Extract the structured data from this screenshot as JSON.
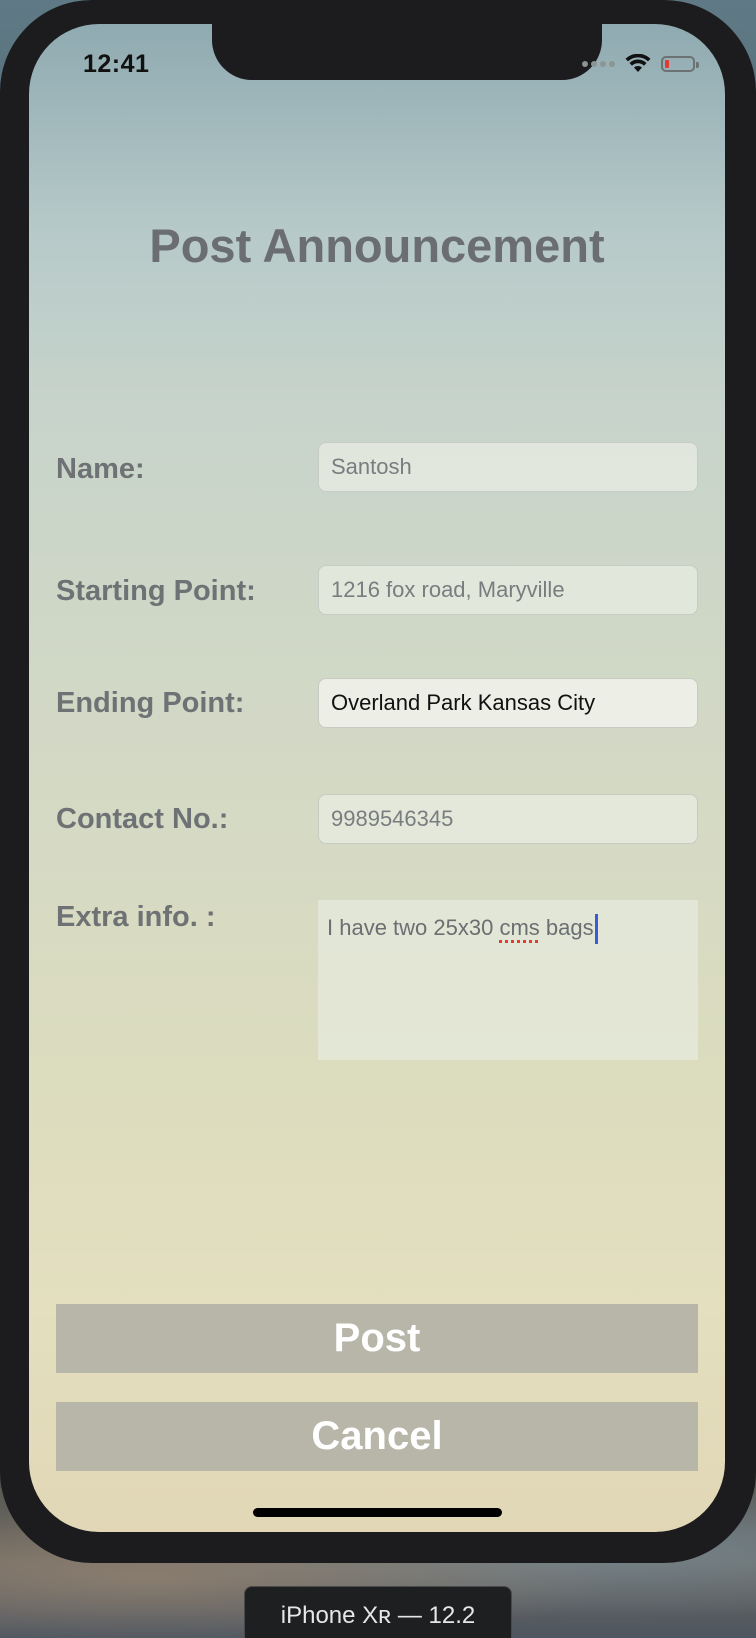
{
  "status_bar": {
    "time": "12:41"
  },
  "page": {
    "title": "Post Announcement"
  },
  "form": {
    "name_label": "Name:",
    "name_value": "Santosh",
    "starting_label": "Starting Point:",
    "starting_value": "1216 fox road, Maryville",
    "ending_label": "Ending Point:",
    "ending_value": "Overland Park Kansas City",
    "contact_label": "Contact No.:",
    "contact_value": "9989546345",
    "extra_label": "Extra info. :",
    "extra_text_before": "I have two 25x30 ",
    "extra_text_misspelled": "cms",
    "extra_text_after": " bags"
  },
  "actions": {
    "post_label": "Post",
    "cancel_label": "Cancel"
  },
  "simulator": {
    "device_label": "iPhone Xʀ — 12.2"
  },
  "colors": {
    "title": "#6a6d71",
    "label": "#6e7275",
    "button_bg": "#b2b0a6",
    "button_text": "#ffffff",
    "caret": "#3a5bd9",
    "battery_low": "#e53935"
  },
  "icons": {
    "signal": "cellular-signal-icon",
    "wifi": "wifi-icon",
    "battery": "battery-icon"
  }
}
